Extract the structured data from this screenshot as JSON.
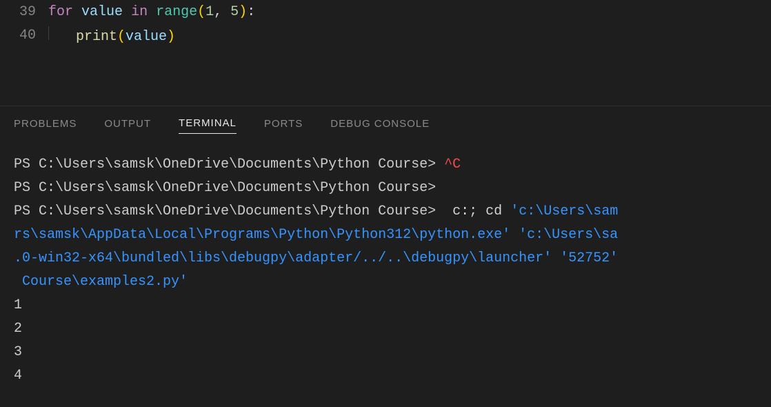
{
  "editor": {
    "lines": [
      {
        "num": "39",
        "indent": 0,
        "tokens": [
          "for",
          " ",
          "value",
          " ",
          "in",
          " ",
          "range",
          "(",
          "1",
          ", ",
          "5",
          ")",
          ":"
        ]
      },
      {
        "num": "40",
        "indent": 1,
        "tokens": [
          "print",
          "(",
          "value",
          ")"
        ]
      }
    ]
  },
  "panel": {
    "tabs": {
      "problems": "PROBLEMS",
      "output": "OUTPUT",
      "terminal": "TERMINAL",
      "ports": "PORTS",
      "debug": "DEBUG CONSOLE"
    },
    "active": "terminal"
  },
  "terminal": {
    "prompt": "PS C:\\Users\\samsk\\OneDrive\\Documents\\Python Course>",
    "line1_suffix": " ",
    "line1_interrupt": "^C",
    "line2_suffix": "",
    "line3_cmd_prefix": "  ",
    "line3_cmd1": "c:",
    "line3_sep": "; ",
    "line3_cmd2": "cd",
    "line3_space": " ",
    "line3_path1": "'c:\\Users\\sam",
    "wrap1": "rs\\samsk\\AppData\\Local\\Programs\\Python\\Python312\\python.exe' 'c:\\Users\\sa",
    "wrap2": ".0-win32-x64\\bundled\\libs\\debugpy\\adapter/../..\\debugpy\\launcher' '52752'",
    "wrap3": " Course\\examples2.py'",
    "outputs": [
      "1",
      "2",
      "3",
      "4"
    ]
  }
}
